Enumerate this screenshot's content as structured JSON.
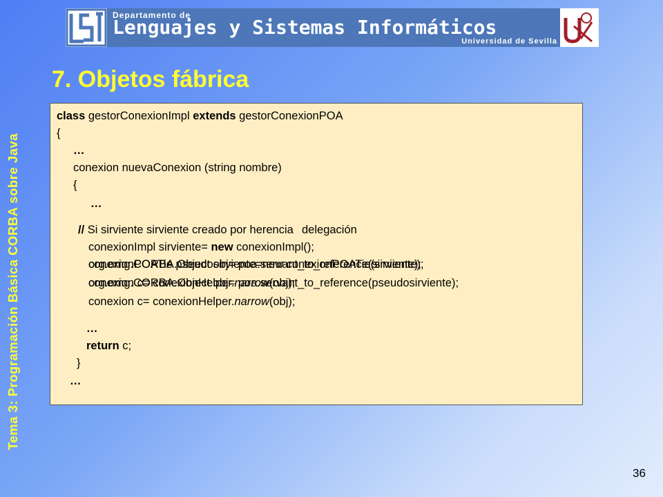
{
  "header": {
    "dept_small": "Departamento de",
    "dept_big": "Lenguajes y Sistemas Informáticos",
    "university": "Universidad de Sevilla"
  },
  "side_title": "Tema 3: Programación Básica CORBA sobre Java",
  "slide_title": "7. Objetos fábrica",
  "code": {
    "l1_kw1": "class",
    "l1_t1": " gestorConexionImpl ",
    "l1_kw2": "extends",
    "l1_t2": " gestorConexionPOA",
    "l2": "{",
    "l3": "…",
    "l4": "conexion nuevaConexion (string nombre)",
    "l5": "{",
    "l6": "…",
    "l7a_kw": "//",
    "l7a": " Si sirviente sirviente creado por herencia",
    "l7b": "delegación",
    "l8_t1": "conexionImpl sirviente= ",
    "l8_kw": "new",
    "l8_t2": " conexionImpl();",
    "l9a": "org.omg.CORBA.Object obj= poa.servant_to_reference(sirviente);",
    "l9b": "conexionPOATie pseudosirviente=new conexionPOATie(sirviente);",
    "l10a_t1": "conexion c= conexionHelper.",
    "l10a_it": "narrow",
    "l10a_t2": "(obj);",
    "l10b": "org.omg.CORBA.Object obj= poa.servant_to_reference(pseudosirviente);",
    "l11_t1": "conexion c= conexionHelper.",
    "l11_it": "narrow",
    "l11_t2": "(obj);",
    "l12": "…",
    "l13_kw": "return",
    "l13_t": " c;",
    "l14": "}",
    "l15": "…"
  },
  "page_number": "36"
}
